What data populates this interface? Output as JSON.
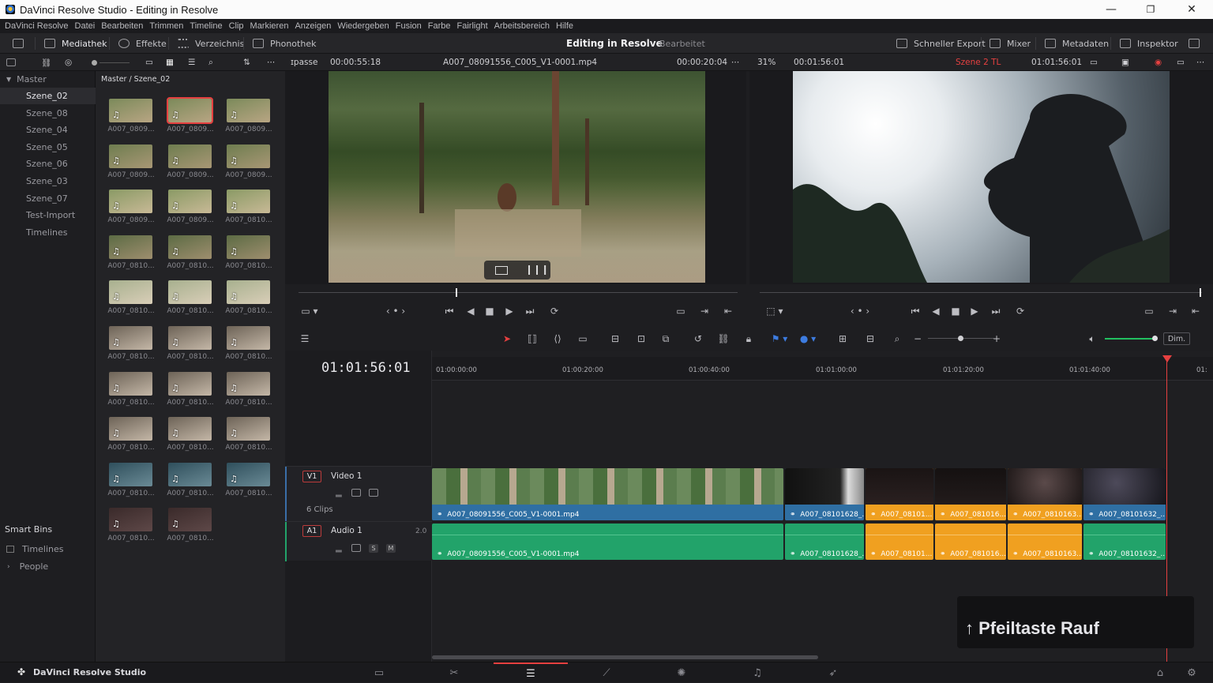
{
  "window": {
    "title": "DaVinci Resolve Studio - Editing in Resolve",
    "minimize": "—",
    "maximize": "❐",
    "close": "✕"
  },
  "menu": [
    "DaVinci Resolve",
    "Datei",
    "Bearbeiten",
    "Trimmen",
    "Timeline",
    "Clip",
    "Markieren",
    "Anzeigen",
    "Wiedergeben",
    "Fusion",
    "Farbe",
    "Fairlight",
    "Arbeitsbereich",
    "Hilfe"
  ],
  "toolbar": {
    "media_pool": "Mediathek",
    "effects": "Effekte",
    "index": "Verzeichnis",
    "sound_library": "Phonothek",
    "project_title": "Editing in Resolve",
    "project_status": "Bearbeitet",
    "quick_export": "Schneller Export",
    "mixer": "Mixer",
    "metadata": "Metadaten",
    "inspector": "Inspektor"
  },
  "subbar": {
    "fit": "ɪpasse",
    "source_timecode": "00:00:55:18",
    "source_clip": "A007_08091556_C005_V1-0001.mp4",
    "source_duration": "00:00:20:04",
    "zoom": "31%",
    "timeline_duration": "00:01:56:01",
    "timeline_name": "Szene 2 TL",
    "timeline_timecode": "01:01:56:01"
  },
  "bins": {
    "master": "Master",
    "items": [
      "Szene_02",
      "Szene_08",
      "Szene_04",
      "Szene_05",
      "Szene_06",
      "Szene_03",
      "Szene_07",
      "Test-Import",
      "Timelines"
    ],
    "smart_bins": "Smart Bins",
    "smart_items": [
      "Timelines",
      "People"
    ]
  },
  "pool": {
    "path": "Master / Szene_02",
    "labels": [
      "A007_0809...",
      "A007_0809...",
      "A007_0809...",
      "A007_0809...",
      "A007_0809...",
      "A007_0809...",
      "A007_0809...",
      "A007_0809...",
      "A007_0810...",
      "A007_0810...",
      "A007_0810...",
      "A007_0810...",
      "A007_0810...",
      "A007_0810...",
      "A007_0810...",
      "A007_0810...",
      "A007_0810...",
      "A007_0810...",
      "A007_0810...",
      "A007_0810...",
      "A007_0810...",
      "A007_0810...",
      "A007_0810...",
      "A007_0810...",
      "A007_0810...",
      "A007_0810...",
      "A007_0810...",
      "A007_0810...",
      "A007_0810..."
    ]
  },
  "timeline": {
    "timecode": "01:01:56:01",
    "ruler": [
      "01:00:00:00",
      "01:00:20:00",
      "01:00:40:00",
      "01:01:00:00",
      "01:01:20:00",
      "01:01:40:00",
      "01:"
    ],
    "v1_tag": "V1",
    "v1_name": "Video 1",
    "clip_count": "6 Clips",
    "a1_tag": "A1",
    "a1_name": "Audio 1",
    "a1_channels": "2.0",
    "solo": "S",
    "mute": "M",
    "dim": "Dim.",
    "video_clips": [
      "A007_08091556_C005_V1-0001.mp4",
      "A007_08101628_...",
      "A007_08101...",
      "A007_081016...",
      "A007_0810163...",
      "A007_08101632_..."
    ],
    "audio_clips": [
      "A007_08091556_C005_V1-0001.mp4",
      "A007_08101628_...",
      "A007_08101...",
      "A007_081016...",
      "A007_0810163...",
      "A007_08101632_..."
    ]
  },
  "toast": {
    "text": "↑ Pfeiltaste Rauf"
  },
  "footer": {
    "brand": "DaVinci Resolve Studio"
  },
  "colors": {
    "accent_red": "#e64040",
    "clip_blue": "#2f6fa3",
    "clip_orange": "#f0a020",
    "clip_green": "#22a36a"
  }
}
